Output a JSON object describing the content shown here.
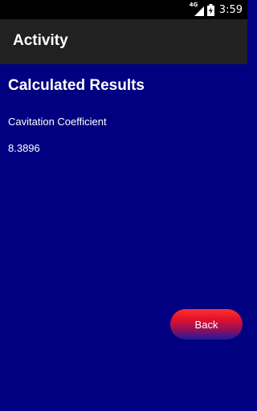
{
  "status_bar": {
    "network": "4G",
    "time": "3:59",
    "icons": [
      "signal-icon",
      "battery-charging-icon"
    ]
  },
  "action_bar": {
    "title": "Activity"
  },
  "main": {
    "title": "Calculated Results",
    "result_label": "Cavitation Coefficient",
    "result_value": "8.3896",
    "back_label": "Back"
  },
  "colors": {
    "background": "#000080",
    "action_bar": "#212121",
    "status_bar": "#000000",
    "button_top": "#ff3030",
    "button_bottom": "#1a1a9a",
    "text": "#ffffff"
  }
}
